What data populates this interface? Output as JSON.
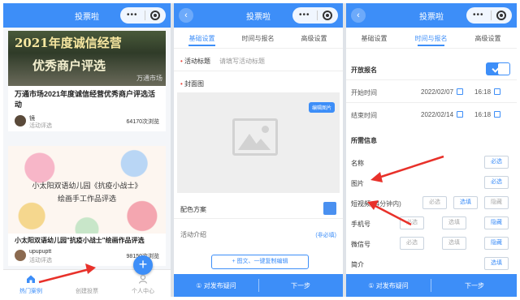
{
  "app": {
    "title": "投票啦"
  },
  "panel1": {
    "cards": [
      {
        "poster_line1": "2021年度诚信经营",
        "poster_line2": "优秀商户评选",
        "poster_tag": "万通市场",
        "title": "万通市场2021年度诚信经营优秀商户评选活动",
        "user": "镜",
        "sub": "活动评选",
        "views": "64170次浏览"
      },
      {
        "poster_line1": "小太阳双语幼儿园《抗疫小战士》",
        "poster_line2": "绘画手工作品评选",
        "title": "小太阳双语幼儿园\"抗疫小战士\"绘画作品评选",
        "user": "upupuptt",
        "sub": "活动评选",
        "views": "98150次浏览"
      }
    ],
    "tabs": [
      {
        "label": "热门案例",
        "icon": "home-icon"
      },
      {
        "label": "创建投票",
        "icon": "plus-icon"
      },
      {
        "label": "个人中心",
        "icon": "user-icon"
      }
    ],
    "fab_symbol": "+"
  },
  "panel2": {
    "subtabs": [
      "基础设置",
      "时间与报名",
      "高级设置"
    ],
    "activity_title_label": "活动标题",
    "activity_title_placeholder": "请填写活动标题",
    "cover_label": "封面图",
    "edit_image": "编辑图片",
    "color_scheme_label": "配色方案",
    "intro_label": "活动介绍",
    "intro_optional": "(非必填)",
    "add_button": "+ 图文、一键复制编辑",
    "bottom_left": "① 对发布疑问",
    "bottom_right": "下一步"
  },
  "panel3": {
    "subtabs": [
      "基础设置",
      "时间与报名",
      "高级设置"
    ],
    "open_signup_label": "开放报名",
    "start_label": "开始时间",
    "start_date": "2022/02/07",
    "start_time": "16:18",
    "end_label": "结束时间",
    "end_date": "2022/02/14",
    "end_time": "16:18",
    "required_info_title": "所需信息",
    "fields": [
      {
        "label": "名称",
        "options": [
          "必选"
        ]
      },
      {
        "label": "图片",
        "options": [
          "必选"
        ]
      },
      {
        "label": "短视频",
        "note": "(4分钟内)",
        "options": [
          "必选",
          "选填",
          "隐藏"
        ]
      },
      {
        "label": "手机号",
        "options": [
          "必选",
          "选填",
          "隐藏"
        ]
      },
      {
        "label": "微信号",
        "options": [
          "必选",
          "选填",
          "隐藏"
        ]
      },
      {
        "label": "简介",
        "options": [
          "选填"
        ]
      }
    ],
    "bottom_left": "① 对发布疑问",
    "bottom_right": "下一步"
  },
  "colors": {
    "primary": "#3d8ef8",
    "annotation_arrow": "#e8312a"
  }
}
